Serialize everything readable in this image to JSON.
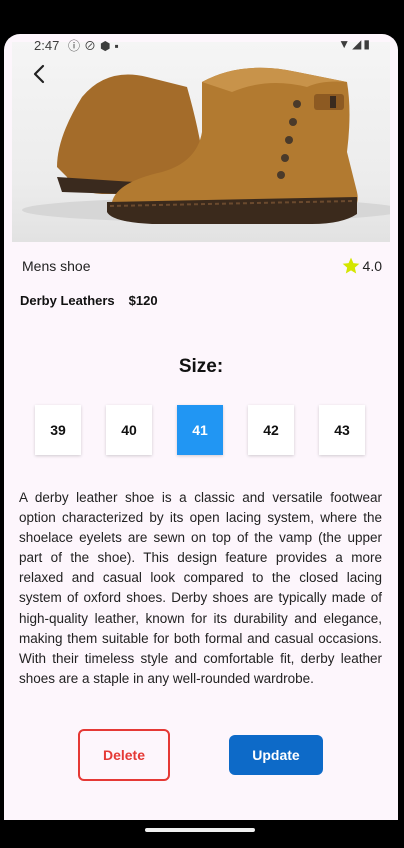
{
  "status_bar": {
    "time": "2:47"
  },
  "product": {
    "category": "Mens shoe",
    "rating": "4.0",
    "name": "Derby Leathers",
    "price": "$120",
    "description": "A derby leather shoe is a classic and versatile footwear option characterized by its open lacing system, where the shoelace eyelets are sewn on top of the vamp (the upper part of the shoe). This design feature provides a more relaxed and casual look compared to the closed lacing system of oxford shoes. Derby shoes are typically made of high-quality leather, known for its durability and elegance, making them suitable for both formal and casual occasions. With their timeless style and comfortable fit, derby leather shoes are a staple in any well-rounded wardrobe."
  },
  "size_section": {
    "title": "Size:",
    "sizes": [
      "39",
      "40",
      "41",
      "42",
      "43"
    ],
    "selected": "41"
  },
  "actions": {
    "delete_label": "Delete",
    "update_label": "Update"
  },
  "colors": {
    "accent": "#2196f3",
    "update": "#0d6ac8",
    "delete": "#e53935",
    "star": "#d4e600",
    "background": "#fdf6fc"
  },
  "icons": {
    "back": "chevron-left-icon",
    "rating": "star-icon"
  }
}
